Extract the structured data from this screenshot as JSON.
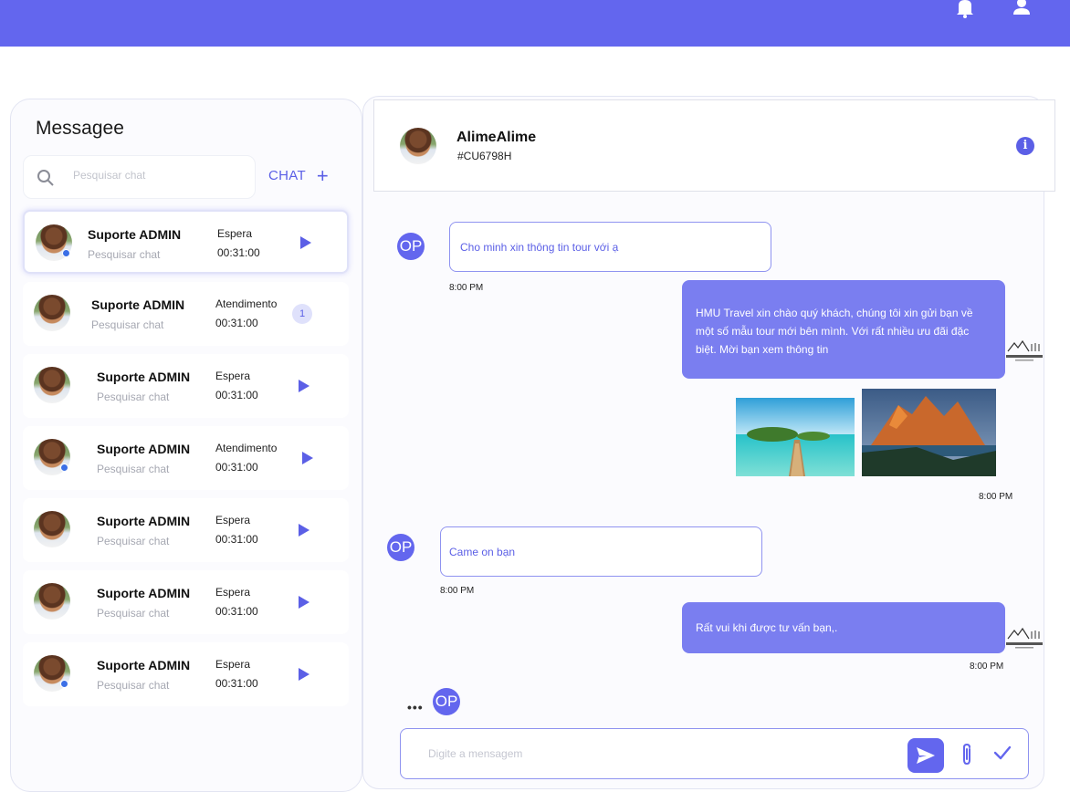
{
  "header": {
    "bell_icon": "bell-icon",
    "user_icon": "user-icon",
    "color": "#6366ee"
  },
  "sidebar": {
    "title": "Messagee",
    "search_placeholder": "Pesquisar chat",
    "new_chat_label": "CHAT",
    "conversations": [
      {
        "name": "Suporte ADMIN",
        "preview": "Pesquisar chat",
        "status": "Espera",
        "time": "00:31:00",
        "online": true,
        "unread": null,
        "active": true
      },
      {
        "name": "Suporte ADMIN",
        "preview": "Pesquisar chat",
        "status": "Atendimento",
        "time": "00:31:00",
        "online": false,
        "unread": "1",
        "active": false
      },
      {
        "name": "Suporte ADMIN",
        "preview": "Pesquisar chat",
        "status": "Espera",
        "time": "00:31:00",
        "online": false,
        "unread": null,
        "active": false
      },
      {
        "name": "Suporte ADMIN",
        "preview": "Pesquisar chat",
        "status": "Atendimento",
        "time": "00:31:00",
        "online": true,
        "unread": null,
        "active": false
      },
      {
        "name": "Suporte ADMIN",
        "preview": "Pesquisar chat",
        "status": "Espera",
        "time": "00:31:00",
        "online": false,
        "unread": null,
        "active": false
      },
      {
        "name": "Suporte ADMIN",
        "preview": "Pesquisar chat",
        "status": "Espera",
        "time": "00:31:00",
        "online": false,
        "unread": null,
        "active": false
      },
      {
        "name": "Suporte ADMIN",
        "preview": "Pesquisar chat",
        "status": "Espera",
        "time": "00:31:00",
        "online": true,
        "unread": null,
        "active": false
      }
    ]
  },
  "chat": {
    "contact_name": "AlimeAlime",
    "contact_id": "#CU6798H",
    "user_initials": "OP",
    "messages": [
      {
        "from": "user",
        "text": "Cho minh xin thông tin tour với ạ",
        "time": "8:00 PM"
      },
      {
        "from": "agent",
        "text": "HMU Travel xin chào quý khách, chúng tôi xin gửi bạn về một số mẫu tour mới bên mình. Với rất nhiều ưu đãi đặc biệt. Mời bạn xem thông tin",
        "time": ""
      },
      {
        "from": "agent",
        "images": [
          "beach-photo",
          "mountain-lake-photo"
        ],
        "time": "8:00 PM"
      },
      {
        "from": "user",
        "text": "Came on bạn",
        "time": "8:00 PM"
      },
      {
        "from": "agent",
        "text": "Rất vui khi được tư vấn bạn,.",
        "time": "8:00 PM"
      }
    ],
    "composer_placeholder": "Digite a mensagem"
  }
}
